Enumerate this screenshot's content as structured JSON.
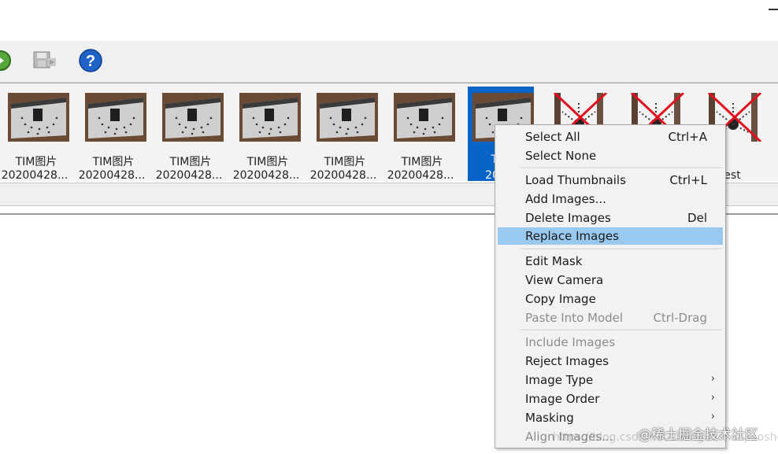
{
  "thumbnails": [
    {
      "line1": "TIM图片",
      "line2": "20200428...",
      "status": "included"
    },
    {
      "line1": "TIM图片",
      "line2": "20200428...",
      "status": "included"
    },
    {
      "line1": "TIM图片",
      "line2": "20200428...",
      "status": "included"
    },
    {
      "line1": "TIM图片",
      "line2": "20200428...",
      "status": "included"
    },
    {
      "line1": "TIM图片",
      "line2": "20200428...",
      "status": "included"
    },
    {
      "line1": "TIM图片",
      "line2": "20200428...",
      "status": "included"
    },
    {
      "line1": "TIM",
      "line2": "2020",
      "status": "selected"
    },
    {
      "line1": "",
      "line2": "",
      "status": "rejected"
    },
    {
      "line1": "",
      "line2": "",
      "status": "rejected"
    },
    {
      "line1": "",
      "line2": "est",
      "status": "rejected"
    }
  ],
  "context_menu": {
    "select_all": {
      "label": "Select All",
      "shortcut": "Ctrl+A"
    },
    "select_none": {
      "label": "Select None"
    },
    "load_thumbnails": {
      "label": "Load Thumbnails",
      "shortcut": "Ctrl+L"
    },
    "add_images": {
      "label": "Add Images..."
    },
    "delete_images": {
      "label": "Delete Images",
      "shortcut": "Del"
    },
    "replace_images": {
      "label": "Replace Images"
    },
    "edit_mask": {
      "label": "Edit Mask"
    },
    "view_camera": {
      "label": "View Camera"
    },
    "copy_image": {
      "label": "Copy Image"
    },
    "paste_into_model": {
      "label": "Paste Into Model",
      "shortcut": "Ctrl-Drag"
    },
    "include_images": {
      "label": "Include Images"
    },
    "reject_images": {
      "label": "Reject Images"
    },
    "image_type": {
      "label": "Image Type"
    },
    "image_order": {
      "label": "Image Order"
    },
    "masking": {
      "label": "Masking"
    },
    "align_images": {
      "label": "Align Images..."
    },
    "submenu_arrow": "›"
  },
  "watermark": "@稀土掘金技术社区",
  "faint_url": "https://blog.csdn.net/zhangdashanjiaoshou",
  "colors": {
    "selection": "#0a64c8",
    "menu_highlight": "#99c9ef",
    "reject_cross": "#e0101e"
  }
}
